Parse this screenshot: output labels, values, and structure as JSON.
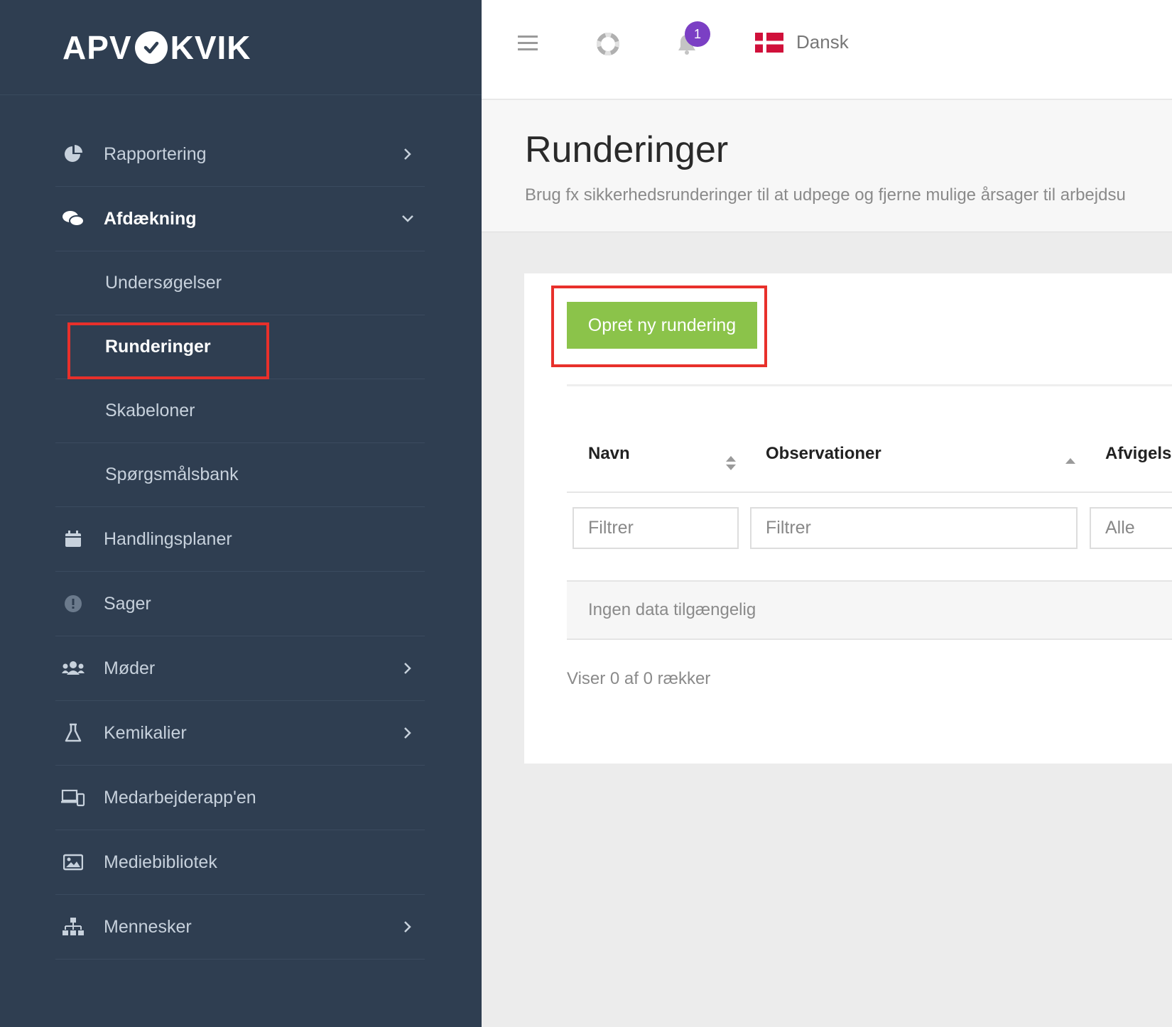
{
  "brand": {
    "logo_left": "APV",
    "logo_right": "KVIK"
  },
  "sidebar": {
    "items": [
      {
        "label": "Rapportering",
        "icon": "pie-chart-icon",
        "has_chevron": true
      },
      {
        "label": "Afdækning",
        "icon": "chat-bubbles-icon",
        "expanded": true
      },
      {
        "label": "Handlingsplaner",
        "icon": "calendar-icon"
      },
      {
        "label": "Sager",
        "icon": "exclamation-circle-icon"
      },
      {
        "label": "Møder",
        "icon": "users-icon",
        "has_chevron": true
      },
      {
        "label": "Kemikalier",
        "icon": "flask-icon",
        "has_chevron": true
      },
      {
        "label": "Medarbejderapp'en",
        "icon": "devices-icon"
      },
      {
        "label": "Mediebibliotek",
        "icon": "image-icon"
      },
      {
        "label": "Mennesker",
        "icon": "org-chart-icon",
        "has_chevron": true
      }
    ],
    "sub_items": [
      {
        "label": "Undersøgelser"
      },
      {
        "label": "Runderinger",
        "active": true
      },
      {
        "label": "Skabeloner"
      },
      {
        "label": "Spørgsmålsbank"
      }
    ]
  },
  "topbar": {
    "notification_count": "1",
    "language": "Dansk"
  },
  "page": {
    "title": "Runderinger",
    "subtitle": "Brug fx sikkerhedsrunderinger til at udpege og fjerne mulige årsager til arbejdsu"
  },
  "card": {
    "create_button": "Opret ny rundering",
    "columns": [
      "Navn",
      "Observationer",
      "Afvigels"
    ],
    "filters": {
      "name_placeholder": "Filtrer",
      "obs_placeholder": "Filtrer",
      "dev_value": "Alle"
    },
    "empty_text": "Ingen data tilgængelig",
    "row_count": "Viser 0 af 0 rækker"
  },
  "colors": {
    "sidebar_bg": "#2f3e51",
    "create_button": "#8bc34a",
    "highlight": "#e8302b",
    "badge": "#7b3fc4"
  }
}
